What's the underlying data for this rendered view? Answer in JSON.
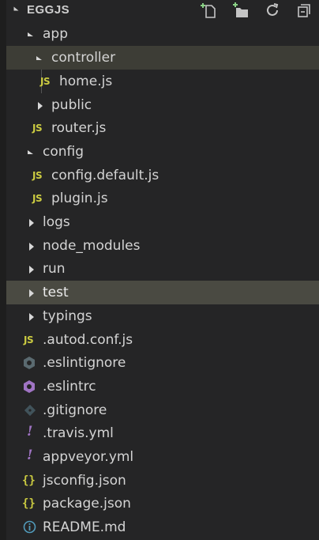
{
  "explorer": {
    "title": "EGGJS",
    "actions": [
      {
        "name": "new-file-icon",
        "label": "New File"
      },
      {
        "name": "new-folder-icon",
        "label": "New Folder"
      },
      {
        "name": "refresh-icon",
        "label": "Refresh"
      },
      {
        "name": "collapse-all-icon",
        "label": "Collapse All"
      }
    ],
    "items": [
      {
        "label": "app",
        "kind": "folder",
        "expanded": true
      },
      {
        "label": "controller",
        "kind": "folder",
        "expanded": true
      },
      {
        "label": "home.js",
        "kind": "js"
      },
      {
        "label": "public",
        "kind": "folder",
        "expanded": false
      },
      {
        "label": "router.js",
        "kind": "js"
      },
      {
        "label": "config",
        "kind": "folder",
        "expanded": true
      },
      {
        "label": "config.default.js",
        "kind": "js"
      },
      {
        "label": "plugin.js",
        "kind": "js"
      },
      {
        "label": "logs",
        "kind": "folder",
        "expanded": false
      },
      {
        "label": "node_modules",
        "kind": "folder",
        "expanded": false
      },
      {
        "label": "run",
        "kind": "folder",
        "expanded": false
      },
      {
        "label": "test",
        "kind": "folder",
        "expanded": false
      },
      {
        "label": "typings",
        "kind": "folder",
        "expanded": false
      },
      {
        "label": ".autod.conf.js",
        "kind": "js"
      },
      {
        "label": ".eslintignore",
        "kind": "eslintignore"
      },
      {
        "label": ".eslintrc",
        "kind": "eslint"
      },
      {
        "label": ".gitignore",
        "kind": "git"
      },
      {
        "label": ".travis.yml",
        "kind": "yml"
      },
      {
        "label": "appveyor.yml",
        "kind": "yml"
      },
      {
        "label": "jsconfig.json",
        "kind": "json"
      },
      {
        "label": "package.json",
        "kind": "json"
      },
      {
        "label": "README.md",
        "kind": "info"
      }
    ],
    "icon_glyphs": {
      "js": "JS",
      "json": "{}",
      "yml": "!"
    },
    "colors": {
      "background": "#252526",
      "selected_row": "#3d3d36",
      "hover_row": "#4a4a42",
      "js_yellow": "#cbcb41",
      "yml_purple": "#a074c4",
      "info_blue": "#519aba",
      "eslint_grey": "#6d8086",
      "eslint_purple": "#a074c4",
      "git_grey": "#41535b"
    }
  }
}
